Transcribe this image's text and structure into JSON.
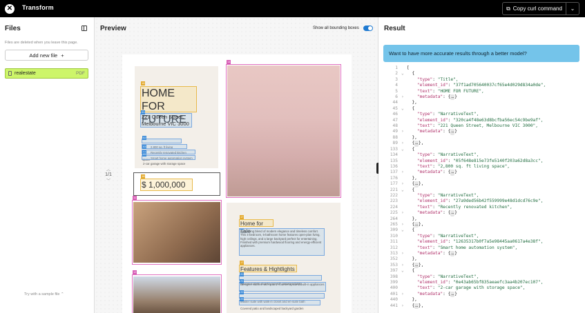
{
  "topbar": {
    "title": "Transform",
    "copy_button": "Copy curl command"
  },
  "files": {
    "heading": "Files",
    "note": "Files are deleted when you leave this page.",
    "add_button": "Add new file",
    "file_name": "realestate",
    "file_type": "PDF",
    "sample_link": "Try with a sample file"
  },
  "preview": {
    "heading": "Preview",
    "bbox_toggle_label": "Show all bounding boxes",
    "bbox_toggle_on": true,
    "page_indicator": "1/1",
    "doc": {
      "title": "HOME FOR FUTURE",
      "address_line1": "221 Queen Street,",
      "address_line2": "Melbourne VIC 3000",
      "features": [
        "2,800 sq. ft living space",
        "Recently renovated kitchen",
        "Smart home automation system",
        "2-car garage with storage space"
      ],
      "price": "$ 1,000,000",
      "for_sale_heading": "Home for sale",
      "description": "A stunning blend of modern elegance and timeless comfort. This 4-bedroom, 5-bathroom home features open-plan living, high ceilings, and a large backyard perfect for entertaining. Finished with premium hardwood flooring and energy-efficient appliances.",
      "features_heading": "Features & Hightlights",
      "highlights": [
        "Spacious open-plan layout with natural lighting",
        "Designer kitchen with quartz countertops and built-in appliances",
        "Master suite with walk-in closet and en-suite bath",
        "Covered patio and landscaped backyard garden"
      ],
      "tags": [
        "16",
        "14",
        "01",
        "02",
        "03",
        "04",
        "05",
        "18",
        "11",
        "17",
        "19",
        "17",
        "20",
        "21",
        "22",
        "23",
        "12"
      ]
    }
  },
  "result": {
    "heading": "Result",
    "banner": "Want to have more accurate results through a better model?",
    "lines": [
      {
        "n": "1",
        "f": "",
        "t": "["
      },
      {
        "n": "2",
        "f": "⌄",
        "t": "  {"
      },
      {
        "n": "3",
        "f": "",
        "k": "    \"type\"",
        "v": "\"Title\","
      },
      {
        "n": "4",
        "f": "",
        "k": "    \"element_id\"",
        "v": "\"37f1ad705640037cf65e4d029d834a0de\","
      },
      {
        "n": "5",
        "f": "",
        "k": "    \"text\"",
        "v": "\"HOME FOR FUTURE\","
      },
      {
        "n": "6",
        "f": "›",
        "k": "    \"metadata\"",
        "e": true
      },
      {
        "n": "44",
        "f": "",
        "t": "  },"
      },
      {
        "n": "45",
        "f": "⌄",
        "t": "  {"
      },
      {
        "n": "46",
        "f": "",
        "k": "    \"type\"",
        "v": "\"NarrativeText\","
      },
      {
        "n": "47",
        "f": "",
        "k": "    \"element_id\"",
        "v": "\"320ca4f48e63d8bcfba56ec54c9be9af\","
      },
      {
        "n": "48",
        "f": "",
        "k": "    \"text\"",
        "v": "\"221 Queen Street, Melbourne VIC 3000\","
      },
      {
        "n": "49",
        "f": "›",
        "k": "    \"metadata\"",
        "e": true
      },
      {
        "n": "88",
        "f": "",
        "t": "  },"
      },
      {
        "n": "89",
        "f": "›",
        "t": "  {",
        "e2": true
      },
      {
        "n": "133",
        "f": "⌄",
        "t": "  {"
      },
      {
        "n": "134",
        "f": "",
        "k": "    \"type\"",
        "v": "\"NarrativeText\","
      },
      {
        "n": "135",
        "f": "",
        "k": "    \"element_id\"",
        "v": "\"05f648e815e73fe5140f203a62d8a3cc\","
      },
      {
        "n": "136",
        "f": "",
        "k": "    \"text\"",
        "v": "\"2,800 sq. ft living space\","
      },
      {
        "n": "137",
        "f": "›",
        "k": "    \"metadata\"",
        "e": true
      },
      {
        "n": "176",
        "f": "",
        "t": "  },"
      },
      {
        "n": "177",
        "f": "›",
        "t": "  {",
        "e2": true
      },
      {
        "n": "221",
        "f": "⌄",
        "t": "  {"
      },
      {
        "n": "222",
        "f": "",
        "k": "    \"type\"",
        "v": "\"NarrativeText\","
      },
      {
        "n": "223",
        "f": "",
        "k": "    \"element_id\"",
        "v": "\"27a9ded56b42f559999e48d1dcd76c9e\","
      },
      {
        "n": "224",
        "f": "",
        "k": "    \"text\"",
        "v": "\"Recently renovated kitchen\","
      },
      {
        "n": "225",
        "f": "›",
        "k": "    \"metadata\"",
        "e": true
      },
      {
        "n": "264",
        "f": "",
        "t": "  },"
      },
      {
        "n": "265",
        "f": "›",
        "t": "  {",
        "e2": true
      },
      {
        "n": "309",
        "f": "⌄",
        "t": "  {"
      },
      {
        "n": "310",
        "f": "",
        "k": "    \"type\"",
        "v": "\"NarrativeText\","
      },
      {
        "n": "311",
        "f": "",
        "k": "    \"element_id\"",
        "v": "\"12635317b0f7a5e98445aa0617a4e38f\","
      },
      {
        "n": "312",
        "f": "",
        "k": "    \"text\"",
        "v": "\"Smart home automation system\","
      },
      {
        "n": "313",
        "f": "›",
        "k": "    \"metadata\"",
        "e": true
      },
      {
        "n": "352",
        "f": "",
        "t": "  },"
      },
      {
        "n": "353",
        "f": "›",
        "t": "  {",
        "e2": true
      },
      {
        "n": "397",
        "f": "⌄",
        "t": "  {"
      },
      {
        "n": "398",
        "f": "",
        "k": "    \"type\"",
        "v": "\"NarrativeText\","
      },
      {
        "n": "399",
        "f": "",
        "k": "    \"element_id\"",
        "v": "\"0e43ab65bf835aeaefc3aa4b207ec107\","
      },
      {
        "n": "400",
        "f": "",
        "k": "    \"text\"",
        "v": "\"2-car garage with storage space\","
      },
      {
        "n": "401",
        "f": "›",
        "k": "    \"metadata\"",
        "e": true
      },
      {
        "n": "440",
        "f": "",
        "t": "  },"
      },
      {
        "n": "441",
        "f": "›",
        "t": "  {",
        "e2": true
      }
    ]
  },
  "colors": {
    "accent_green": "#cdf56a",
    "banner": "#74c4ea",
    "toggle": "#1f7ad1"
  }
}
